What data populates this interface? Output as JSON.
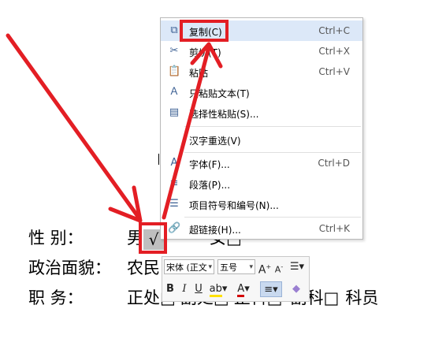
{
  "document": {
    "line1": {
      "label": "性    别：",
      "v1": "男",
      "check": "√",
      "v2": "女□"
    },
    "line2": {
      "label": "政治面貌：",
      "v1": "农民"
    },
    "line3": {
      "label": "职    务：",
      "v1": "正处□",
      "v2": "副处□",
      "v3": "正科□",
      "v4": "副科□",
      "v5": "科员"
    }
  },
  "context_menu": {
    "items": [
      {
        "icon": "copy-icon",
        "label": "复制(C)",
        "shortcut": "Ctrl+C"
      },
      {
        "icon": "scissors-icon",
        "label": "剪切(T)",
        "shortcut": "Ctrl+X"
      },
      {
        "icon": "paste-icon",
        "label": "粘贴",
        "shortcut": "Ctrl+V"
      },
      {
        "icon": "paste-text-icon",
        "label": "只粘贴文本(T)",
        "shortcut": ""
      },
      {
        "icon": "paste-special-icon",
        "label": "选择性粘贴(S)...",
        "shortcut": ""
      },
      {
        "icon": "",
        "label": "汉字重选(V)",
        "shortcut": ""
      },
      {
        "icon": "font-icon",
        "label": "字体(F)...",
        "shortcut": "Ctrl+D"
      },
      {
        "icon": "paragraph-icon",
        "label": "段落(P)...",
        "shortcut": ""
      },
      {
        "icon": "list-icon",
        "label": "项目符号和编号(N)...",
        "shortcut": ""
      },
      {
        "icon": "hyperlink-icon",
        "label": "超链接(H)...",
        "shortcut": "Ctrl+K"
      }
    ]
  },
  "mini_toolbar": {
    "font_name": "宋体 (正文",
    "font_size": "五号",
    "grow_font": "A",
    "shrink_font": "A",
    "bold": "B",
    "italic": "I",
    "underline": "U",
    "font_color_letter": "A"
  },
  "colors": {
    "highlight": "#e31e24",
    "menu_hover": "#dce8f8"
  }
}
